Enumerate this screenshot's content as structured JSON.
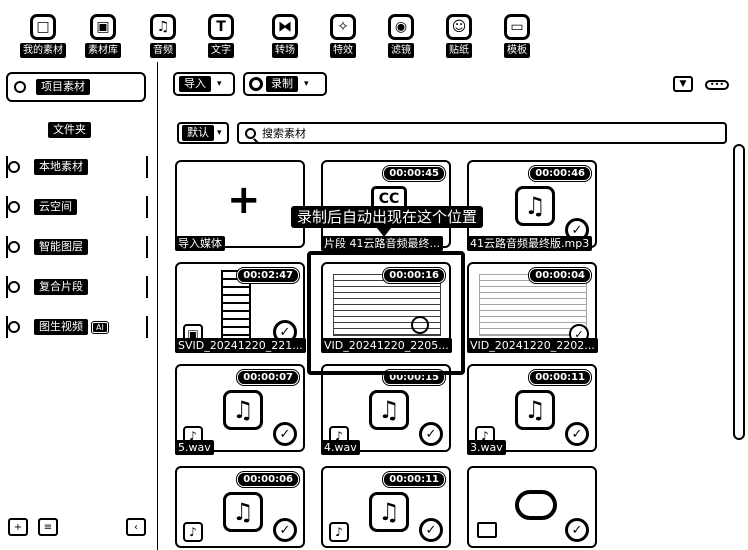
{
  "toolbar": {
    "tabs": [
      {
        "label": "我的素材",
        "icon": "folder-icon",
        "glyph": "□"
      },
      {
        "label": "素材库",
        "icon": "library-icon",
        "glyph": "▣"
      },
      {
        "label": "音频",
        "icon": "music-icon",
        "glyph": "♫"
      },
      {
        "label": "文字",
        "icon": "text-icon",
        "glyph": "T"
      },
      {
        "label": "转场",
        "icon": "transition-icon",
        "glyph": "⧓"
      },
      {
        "label": "特效",
        "icon": "effects-icon",
        "glyph": "✧"
      },
      {
        "label": "滤镜",
        "icon": "filter-icon",
        "glyph": "◉"
      },
      {
        "label": "贴纸",
        "icon": "sticker-icon",
        "glyph": "☺"
      },
      {
        "label": "模板",
        "icon": "template-icon",
        "glyph": "▭"
      }
    ]
  },
  "sidebar": {
    "project_label": "项目素材",
    "folder_label": "文件夹",
    "items": [
      {
        "label": "本地素材"
      },
      {
        "label": "云空间"
      },
      {
        "label": "智能图层"
      },
      {
        "label": "复合片段"
      },
      {
        "label": "图生视频",
        "badge": "AI"
      }
    ]
  },
  "main": {
    "import_label": "导入",
    "record_label": "录制",
    "sort_label": "默认",
    "search_placeholder": "搜索素材",
    "tooltip": "录制后自动出现在这个位置"
  },
  "grid": [
    {
      "type": "import",
      "caption": "导入媒体"
    },
    {
      "type": "cc",
      "duration": "00:00:45",
      "caption": "片段 41云路音频最终..."
    },
    {
      "type": "audio",
      "duration": "00:00:46",
      "caption": "41云路音频最终版.mp3"
    },
    {
      "type": "phone",
      "duration": "00:02:47",
      "caption": "SVID_20241220_221..."
    },
    {
      "type": "screen",
      "duration": "00:00:16",
      "caption": "VID_20241220_2205..."
    },
    {
      "type": "screen2",
      "duration": "00:00:04",
      "caption": "VID_20241220_2202..."
    },
    {
      "type": "audio",
      "duration": "00:00:07",
      "caption": "5.wav"
    },
    {
      "type": "audio",
      "duration": "00:00:15",
      "caption": "4.wav"
    },
    {
      "type": "audio",
      "duration": "00:00:11",
      "caption": "3.wav"
    },
    {
      "type": "audio",
      "duration": "00:00:06",
      "caption": ""
    },
    {
      "type": "audio",
      "duration": "00:00:11",
      "caption": ""
    },
    {
      "type": "cloud",
      "duration": "",
      "caption": ""
    }
  ]
}
